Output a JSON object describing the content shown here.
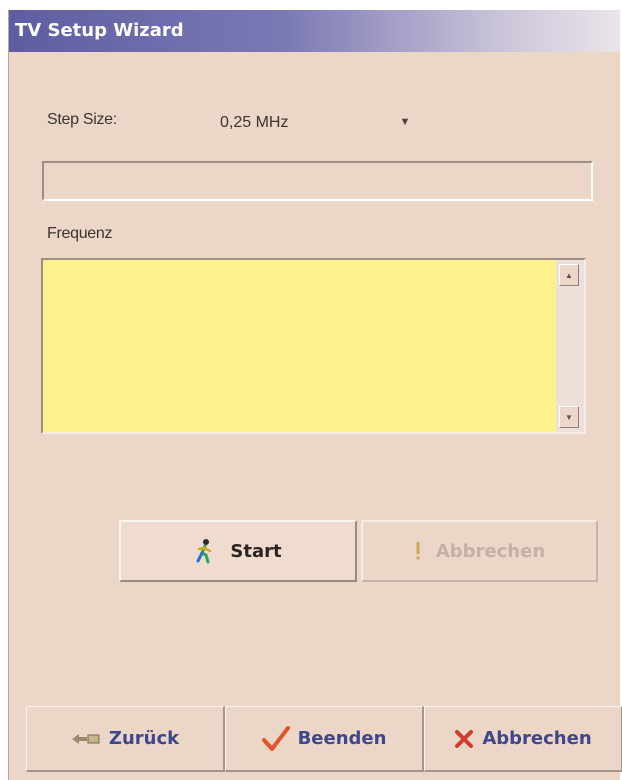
{
  "window": {
    "title": "TV Setup Wizard"
  },
  "scan": {
    "step_size_label": "Step Size:",
    "step_size_value": "0,25 MHz",
    "status_text": "",
    "frequency_label": "Frequenz",
    "frequencies": []
  },
  "actions": {
    "start_label": "Start",
    "abort_label": "Abbrechen"
  },
  "nav": {
    "back_label": "Zurück",
    "finish_label": "Beenden",
    "cancel_label": "Abbrechen"
  },
  "icons": {
    "start": "running-man-icon",
    "abort": "exclamation-icon",
    "back": "back-arrow-icon",
    "finish": "checkmark-icon",
    "cancel": "red-x-icon"
  },
  "colors": {
    "window_bg": "#ecd6c7",
    "list_bg": "#fdf08e",
    "title_gradient_start": "#5e5da2",
    "nav_text": "#3e4789",
    "finish_check": "#e2572a",
    "cancel_x": "#d23a2a"
  }
}
